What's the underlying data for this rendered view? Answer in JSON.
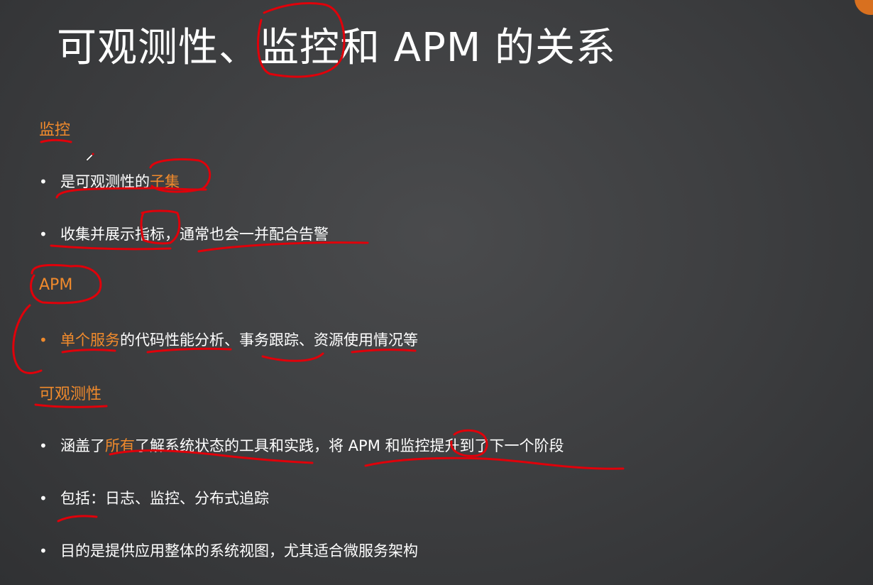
{
  "title": "可观测性、监控和 APM 的关系",
  "colors": {
    "accent": "#f08a2c",
    "annotation": "#e0000a",
    "background": "#3f4042"
  },
  "sections": [
    {
      "heading": "监控",
      "bullets": [
        [
          "是可观测性的",
          "子集"
        ],
        [
          "收集并展示指标，通常也会一并配合告警"
        ]
      ]
    },
    {
      "heading": "APM",
      "bullets": [
        [
          "单个服务",
          "的代码性能分析、事务跟踪、资源使用情况等"
        ]
      ]
    },
    {
      "heading": "可观测性",
      "bullets": [
        [
          "涵盖了",
          "所有",
          "了解系统状态的工具和实践，将 APM 和监控提升到了下一个阶段"
        ],
        [
          "包括：日志、监控、分布式追踪"
        ],
        [
          "目的是提供应用整体的系统视图，尤其适合微服务架构"
        ]
      ]
    }
  ],
  "bullet_symbol": "•",
  "icons": {
    "cursor": "pen-cursor-icon"
  }
}
